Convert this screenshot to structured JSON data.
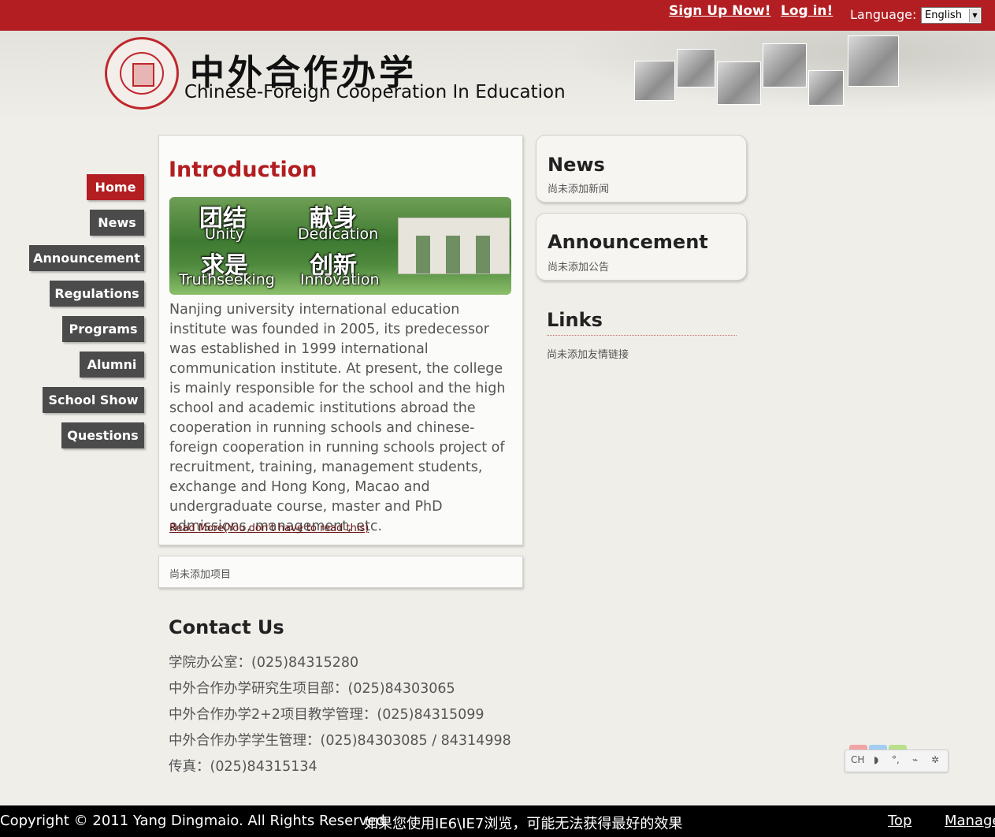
{
  "topbar": {
    "signup": "Sign Up Now!",
    "login": "Log in!",
    "language_label": "Language:",
    "language_value": "English"
  },
  "header": {
    "title_cn": "中外合作办学",
    "title_en": "Chinese-Foreign Cooperation In Education"
  },
  "nav": [
    "Home",
    "News",
    "Announcement",
    "Regulations",
    "Programs",
    "Alumni",
    "School Show",
    "Questions"
  ],
  "intro": {
    "title": "Introduction",
    "banner_cn_1": "团结",
    "banner_en_1": "Unity",
    "banner_cn_2": "献身",
    "banner_en_2": "Dedication",
    "banner_cn_3": "求是",
    "banner_en_3": "Truthseeking",
    "banner_cn_4": "创新",
    "banner_en_4": "Innovation",
    "text": "Nanjing university international education institute was founded in 2005, its predecessor was established in 1999 international communication institute. At present, the college is mainly responsible for the school and the high school and academic institutions abroad the cooperation in running schools and chinese-foreign cooperation in running schools project of recruitment, training, management students, exchange and Hong Kong, Macao and undergraduate course, master and PhD admissions, management, etc.",
    "read_more": "Read More(You don't have to read this)"
  },
  "projects": {
    "empty": "尚未添加项目"
  },
  "news": {
    "title": "News",
    "empty": "尚未添加新闻"
  },
  "announcement": {
    "title": "Announcement",
    "empty": "尚未添加公告"
  },
  "links": {
    "title": "Links",
    "empty": "尚未添加友情链接"
  },
  "contact": {
    "title": "Contact Us",
    "lines": [
      "学院办公室：(025)84315280",
      "中外合作办学研究生项目部：(025)84303065",
      "中外合作办学2+2项目教学管理：(025)84315099",
      "中外合作办学学生管理：(025)84303085 / 84314998",
      "传真：(025)84315134"
    ]
  },
  "widget": {
    "label": "CH"
  },
  "footer": {
    "copyright": "Copyright © 2011 Yang Dingmaio. All Rights Reserved",
    "notice": "如果您使用IE6\\IE7浏览，可能无法获得最好的效果",
    "top": "Top",
    "manage": "Manage"
  },
  "colors": {
    "brand_red": "#b21e21",
    "nav_gray": "#4b4b4b",
    "background": "#efeee9"
  }
}
